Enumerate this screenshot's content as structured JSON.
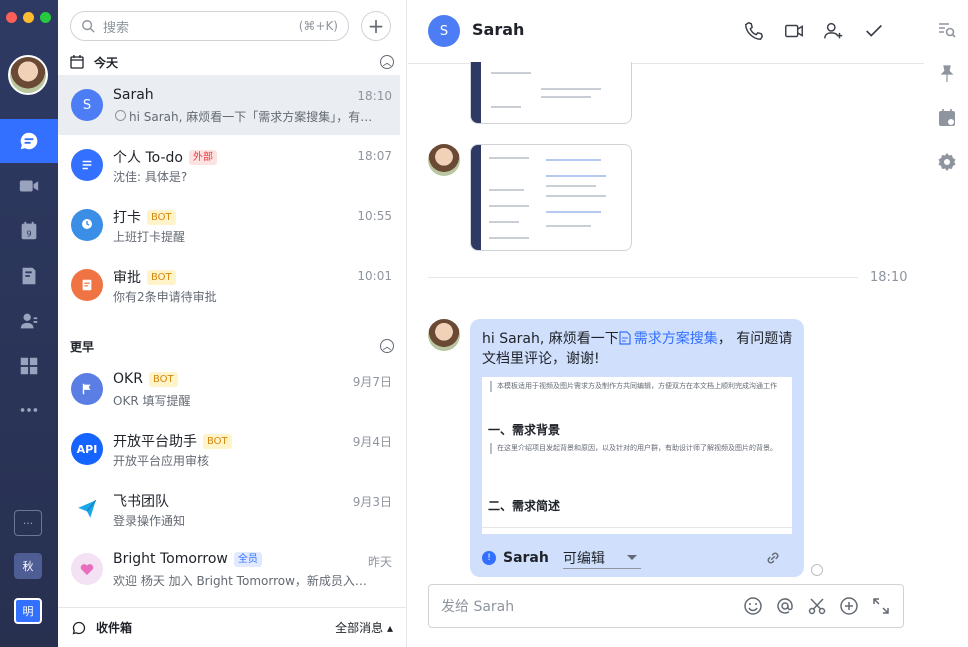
{
  "rail": {
    "colors": {
      "close": "#ff5f57",
      "minimize": "#febc2e",
      "maximize": "#28c840",
      "accent": "#3370ff"
    },
    "bottom_avatars": [
      "秋",
      "明"
    ]
  },
  "list": {
    "search_placeholder": "搜索",
    "search_shortcut": "(⌘+K)",
    "section_today": "今天",
    "section_earlier": "更早",
    "today": [
      {
        "name": "Sarah",
        "avatar": "S",
        "time": "18:10",
        "preview": "hi Sarah, 麻烦看一下「需求方案搜集」，有问题请文档里评论，谢谢！"
      },
      {
        "name": "个人 To-do",
        "tag": "外部",
        "time": "18:07",
        "preview": "沈佳: 具体是?"
      },
      {
        "name": "打卡",
        "tag": "BOT",
        "time": "10:55",
        "preview": "上班打卡提醒"
      },
      {
        "name": "审批",
        "tag": "BOT",
        "time": "10:01",
        "preview": "你有2条申请待审批"
      }
    ],
    "earlier": [
      {
        "name": "OKR",
        "tag": "BOT",
        "time": "9月7日",
        "preview": "OKR 填写提醒"
      },
      {
        "name": "开放平台助手",
        "tag": "BOT",
        "time": "9月4日",
        "preview": "开放平台应用审核"
      },
      {
        "name": "飞书团队",
        "time": "9月3日",
        "preview": "登录操作通知"
      },
      {
        "name": "Bright Tomorrow",
        "tag": "全员",
        "time": "昨天",
        "preview": "欢迎 杨天 加入 Bright Tomorrow，新成员入群请大家多多关照"
      }
    ],
    "footer_inbox": "收件箱",
    "footer_all": "全部消息"
  },
  "conversation": {
    "title": "Sarah",
    "avatar": "S",
    "divider_time": "18:10",
    "message": {
      "text_before": "hi Sarah, 麻烦看一下",
      "doc_link": "需求方案搜集",
      "text_after": "， 有问题请文档里评论，谢谢!"
    },
    "doc_preview": {
      "intro": "本模板适用于视频及图片需求方及制作方共同编辑，方便双方在本文档上顺利完成沟通工作",
      "h1": "一、需求背景",
      "body1": "在这里介绍项目发起背景和原因，以及针对的用户群，有助设计师了解视频及图片的背景。",
      "h2": "二、需求简述"
    },
    "doc_owner": "Sarah",
    "doc_permission": "可编辑",
    "composer_placeholder": "发给 Sarah"
  }
}
